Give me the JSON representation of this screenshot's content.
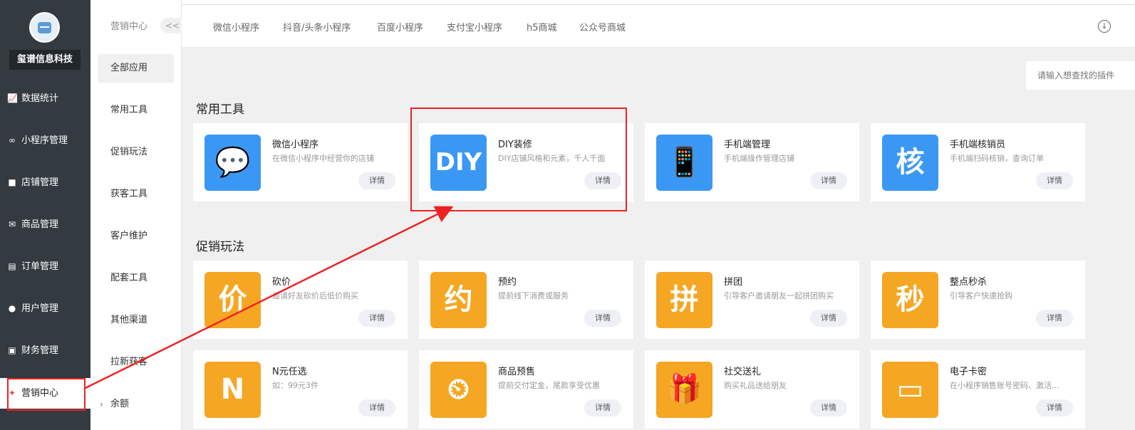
{
  "sidebar": {
    "brand": "玺谱信息科技",
    "items": [
      {
        "icon": "chart-icon",
        "label": "数据统计"
      },
      {
        "icon": "link-icon",
        "label": "小程序管理"
      },
      {
        "icon": "store-icon",
        "label": "店铺管理"
      },
      {
        "icon": "goods-icon",
        "label": "商品管理"
      },
      {
        "icon": "order-icon",
        "label": "订单管理"
      },
      {
        "icon": "user-icon",
        "label": "用户管理"
      },
      {
        "icon": "finance-icon",
        "label": "财务管理"
      },
      {
        "icon": "marketing-icon",
        "label": "营销中心"
      }
    ]
  },
  "subnav": {
    "title": "营销中心",
    "collapse": "<<",
    "items": [
      "全部应用",
      "常用工具",
      "促销玩法",
      "获客工具",
      "客户维护",
      "配套工具",
      "其他渠道",
      "拉新获客",
      "余额"
    ],
    "selected": "全部应用"
  },
  "topbar": {
    "tabs": [
      "微信小程序",
      "抖音/头条小程序",
      "百度小程序",
      "支付宝小程序",
      "h5商城",
      "公众号商城"
    ]
  },
  "search": {
    "placeholder": "请输入想查找的插件"
  },
  "sections": {
    "common": "常用工具",
    "promo": "促销玩法"
  },
  "detail_label": "详情",
  "cards": [
    {
      "name": "微信小程序",
      "desc": "在微信小程序中经营你的店铺",
      "glyph": "💬",
      "color": "blue"
    },
    {
      "name": "DIY装修",
      "desc": "DIY店铺风格和元素，千人千面",
      "glyph": "DIY",
      "color": "blue"
    },
    {
      "name": "手机端管理",
      "desc": "手机端操作管理店铺",
      "glyph": "📱",
      "color": "blue"
    },
    {
      "name": "手机端核销员",
      "desc": "手机端扫码核销，查询订单",
      "glyph": "核",
      "color": "blue"
    },
    {
      "name": "砍价",
      "desc": "邀请好友砍价后低价购买",
      "glyph": "价",
      "color": "orange"
    },
    {
      "name": "预约",
      "desc": "提前线下消费或服务",
      "glyph": "约",
      "color": "orange"
    },
    {
      "name": "拼团",
      "desc": "引导客户邀请朋友一起拼团购买",
      "glyph": "拼",
      "color": "orange"
    },
    {
      "name": "整点秒杀",
      "desc": "引导客户快速抢购",
      "glyph": "秒",
      "color": "orange"
    },
    {
      "name": "N元任选",
      "desc": "如：99元3件",
      "glyph": "N",
      "color": "orange"
    },
    {
      "name": "商品预售",
      "desc": "提前交付定金，尾款享受优惠",
      "glyph": "⏲",
      "color": "orange"
    },
    {
      "name": "社交送礼",
      "desc": "购买礼品送给朋友",
      "glyph": "🎁",
      "color": "orange"
    },
    {
      "name": "电子卡密",
      "desc": "在小程序销售账号密码、激活...",
      "glyph": "▭",
      "color": "orange"
    }
  ],
  "colors": {
    "sidebar": "#333a40",
    "blue": "#3a98f4",
    "orange": "#f5a623",
    "annotation": "#e22222"
  }
}
